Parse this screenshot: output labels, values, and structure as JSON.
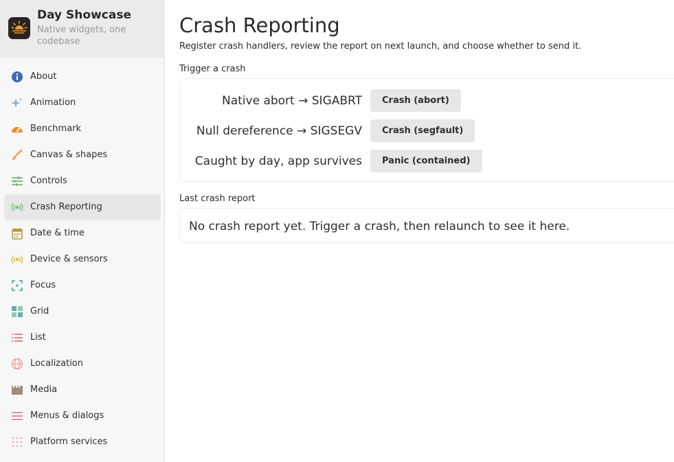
{
  "app": {
    "title": "Day Showcase",
    "subtitle": "Native widgets, one codebase"
  },
  "sidebar": {
    "items": [
      {
        "label": "About",
        "icon": "info-icon",
        "color": "#3d6fb0"
      },
      {
        "label": "Animation",
        "icon": "sparkle-icon",
        "color": "#7fb2e0"
      },
      {
        "label": "Benchmark",
        "icon": "speedometer-icon",
        "color": "#f08a24"
      },
      {
        "label": "Canvas & shapes",
        "icon": "brush-icon",
        "color": "#f0a040"
      },
      {
        "label": "Controls",
        "icon": "sliders-icon",
        "color": "#6fae6f"
      },
      {
        "label": "Crash Reporting",
        "icon": "broadcast-icon",
        "color": "#7dc07d"
      },
      {
        "label": "Date & time",
        "icon": "calendar-icon",
        "color": "#b89a2e"
      },
      {
        "label": "Device & sensors",
        "icon": "sensor-icon",
        "color": "#e8c040"
      },
      {
        "label": "Focus",
        "icon": "focus-icon",
        "color": "#3aa3a3"
      },
      {
        "label": "Grid",
        "icon": "grid-icon",
        "color": "#5fb0a8"
      },
      {
        "label": "List",
        "icon": "list-icon",
        "color": "#e05a6a"
      },
      {
        "label": "Localization",
        "icon": "globe-icon",
        "color": "#f09a9a"
      },
      {
        "label": "Media",
        "icon": "film-icon",
        "color": "#a08a78"
      },
      {
        "label": "Menus & dialogs",
        "icon": "menu-icon",
        "color": "#e06a80"
      },
      {
        "label": "Platform services",
        "icon": "dots-grid-icon",
        "color": "#f0a8b0"
      }
    ],
    "active_index": 5
  },
  "main": {
    "title": "Crash Reporting",
    "description": "Register crash handlers, review the report on next launch, and choose whether to send it.",
    "trigger_section": {
      "label": "Trigger a crash",
      "rows": [
        {
          "label": "Native abort → SIGABRT",
          "button": "Crash (abort)"
        },
        {
          "label": "Null dereference → SIGSEGV",
          "button": "Crash (segfault)"
        },
        {
          "label": "Caught by day, app survives",
          "button": "Panic (contained)"
        }
      ]
    },
    "report_section": {
      "label": "Last crash report",
      "text": "No crash report yet. Trigger a crash, then relaunch to see it here."
    }
  }
}
